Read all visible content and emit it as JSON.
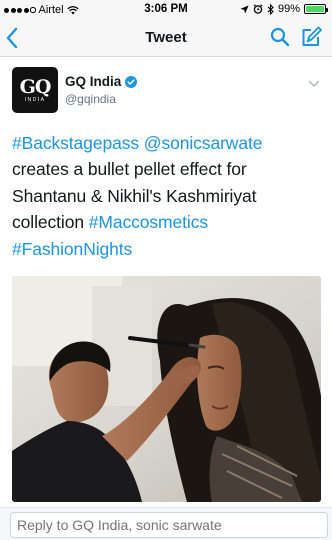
{
  "status_bar": {
    "carrier": "Airtel",
    "time": "3:06 PM",
    "battery": "99%",
    "battery_level": 0.99,
    "signal_bars": 4
  },
  "nav": {
    "title": "Tweet",
    "back_icon": "chevron-left-icon",
    "search_icon": "search-icon",
    "compose_icon": "compose-icon"
  },
  "tweet": {
    "author": {
      "name": "GQ India",
      "handle": "@gqindia",
      "avatar_text": "GQ",
      "avatar_subtext": "INDIA",
      "verified": true
    },
    "text": {
      "hashtag1": "#Backstagepass",
      "mention": "@sonicsarwate",
      "body": "creates a bullet pellet effect for Shantanu & Nikhil's Kashmiriyat collection",
      "hashtag2": "#Maccosmetics",
      "hashtag3": "#FashionNights"
    }
  },
  "reply": {
    "placeholder": "Reply to GQ India, sonic sarwate"
  },
  "colors": {
    "accent": "#1b95e0",
    "battery": "#4cd964"
  }
}
